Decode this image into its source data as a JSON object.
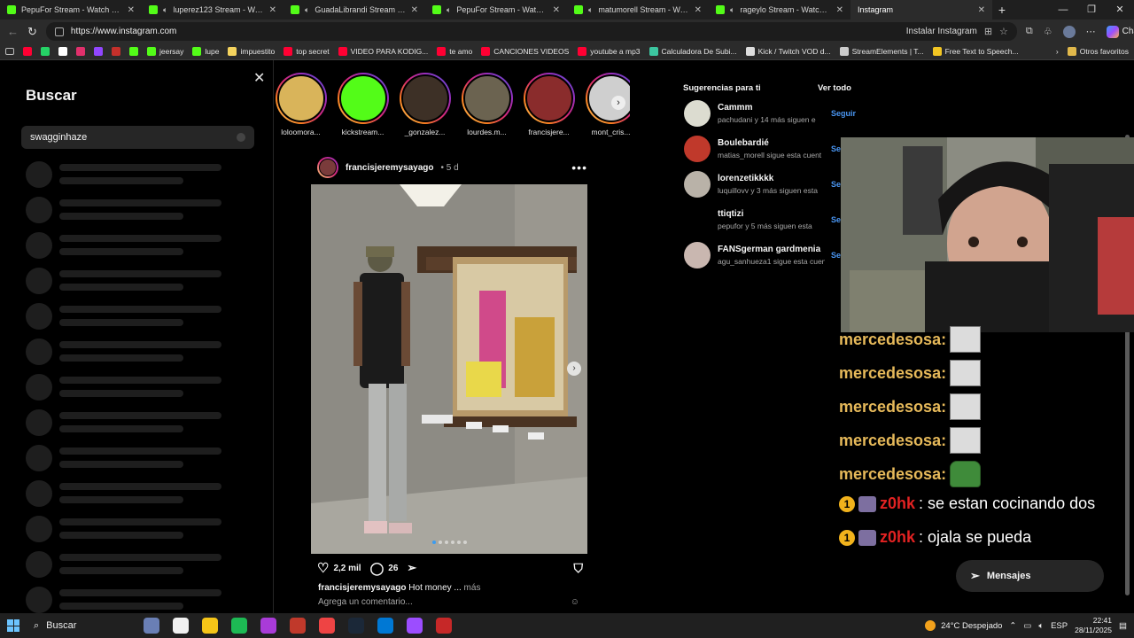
{
  "browser": {
    "tabs": [
      {
        "title": "PepuFor Stream - Watch Live",
        "icon": "kick",
        "audio": false
      },
      {
        "title": "luperez123 Stream - Watch Live",
        "icon": "kick",
        "audio": true
      },
      {
        "title": "GuadaLibrandi Stream - Watch Live",
        "icon": "kick",
        "audio": true
      },
      {
        "title": "PepuFor Stream - Watch Live",
        "icon": "kick",
        "audio": true
      },
      {
        "title": "matumorell Stream - Watch Live",
        "icon": "kick",
        "audio": true
      },
      {
        "title": "rageylo Stream - Watch Live",
        "icon": "kick",
        "audio": true
      },
      {
        "title": "Instagram",
        "icon": "instagram",
        "audio": false,
        "active": true
      }
    ],
    "url": "https://www.instagram.com",
    "install_label": "Instalar Instagram",
    "chat_label": "Chat",
    "bookmarks": [
      {
        "label": "",
        "color": "#ff0033"
      },
      {
        "label": "",
        "color": "#25d366"
      },
      {
        "label": "",
        "color": "#ffffff"
      },
      {
        "label": "",
        "color": "#e1306c"
      },
      {
        "label": "",
        "color": "#9146ff"
      },
      {
        "label": "",
        "color": "#c4302b"
      },
      {
        "label": "",
        "color": "#53fc18"
      },
      {
        "label": "jeersay",
        "color": "#53fc18"
      },
      {
        "label": "lupe",
        "color": "#53fc18"
      },
      {
        "label": "impuestito",
        "color": "#f4d35e"
      },
      {
        "label": "top secret",
        "color": "#ff0033"
      },
      {
        "label": "VIDEO PARA KODIG...",
        "color": "#ff0033"
      },
      {
        "label": "te amo",
        "color": "#ff0033"
      },
      {
        "label": "CANCIONES VIDEOS",
        "color": "#ff0033"
      },
      {
        "label": "youtube a mp3",
        "color": "#ff0033"
      },
      {
        "label": "Calculadora De Subi...",
        "color": "#3cc6a0"
      },
      {
        "label": "Kick / Twitch VOD d...",
        "color": "#dddddd"
      },
      {
        "label": "StreamElements | T...",
        "color": "#cccccc"
      },
      {
        "label": "Free Text to Speech...",
        "color": "#f3c623"
      }
    ],
    "other_bookmarks": "Otros favoritos"
  },
  "search_panel": {
    "title": "Buscar",
    "query": "swagginhaze"
  },
  "stories": [
    {
      "name": "loloomora...",
      "color": "#d9b45a"
    },
    {
      "name": "kickstream...",
      "color": "#53fc18"
    },
    {
      "name": "_gonzalez...",
      "color": "#3d3026"
    },
    {
      "name": "lourdes.m...",
      "color": "#6b6350"
    },
    {
      "name": "francisjere...",
      "color": "#8a2c2c"
    },
    {
      "name": "mont_cris...",
      "color": "#cfcfcf"
    }
  ],
  "post": {
    "username": "francisjeremysayago",
    "time": "5 d",
    "likes": "2,2 mil",
    "comments": "26",
    "caption_text": "Hot money ...",
    "caption_more": "más",
    "comment_placeholder": "Agrega un comentario..."
  },
  "suggestions": {
    "title": "Sugerencias para ti",
    "see_all": "Ver todo",
    "follow_label": "Seguir",
    "items": [
      {
        "name": "Cammm",
        "sub": "pachudani y 14 más siguen e",
        "color": "#dcdcd0"
      },
      {
        "name": "Boulebardié",
        "sub": "matias_morell sigue esta cuent",
        "color": "#c0392b"
      },
      {
        "name": "lorenzetikkkk",
        "sub": "luquillovv y 3 más siguen esta",
        "color": "#b9b2a8"
      },
      {
        "name": "ttiqtizi",
        "sub": "pepufor y 5 más siguen esta",
        "color": "#000000"
      },
      {
        "name": "FANSgerman gardmenia",
        "sub": "agu_sanhueza1 sigue esta cuen",
        "color": "#c9b7b0"
      }
    ]
  },
  "stream_chat": [
    {
      "user": "mercedesosa:",
      "text": "",
      "emote": "hat-drawing",
      "red": false
    },
    {
      "user": "mercedesosa:",
      "text": "",
      "emote": "hat-drawing",
      "red": false
    },
    {
      "user": "mercedesosa:",
      "text": "",
      "emote": "hat-drawing",
      "red": false
    },
    {
      "user": "mercedesosa:",
      "text": "",
      "emote": "hat-drawing",
      "red": false
    },
    {
      "user": "mercedesosa:",
      "text": "",
      "emote": "pepe",
      "red": false
    },
    {
      "user": "z0hk",
      "text": ": se estan cocinando dos",
      "emote": "",
      "red": true
    },
    {
      "user": "z0hk",
      "text": ": ojala se pueda",
      "emote": "",
      "red": true
    }
  ],
  "messages_label": "Mensajes",
  "taskbar": {
    "search_label": "Buscar",
    "apps": [
      "#6a7fb5",
      "#f0f0f0",
      "#f5c518",
      "#1db954",
      "#a93bd8",
      "#c0392b",
      "#e44",
      "#1b2838",
      "#0078d4",
      "#9c4dff",
      "#c62828"
    ],
    "weather": "24°C Despejado",
    "lang": "ESP",
    "time": "22:41",
    "date": "28/11/2025"
  }
}
